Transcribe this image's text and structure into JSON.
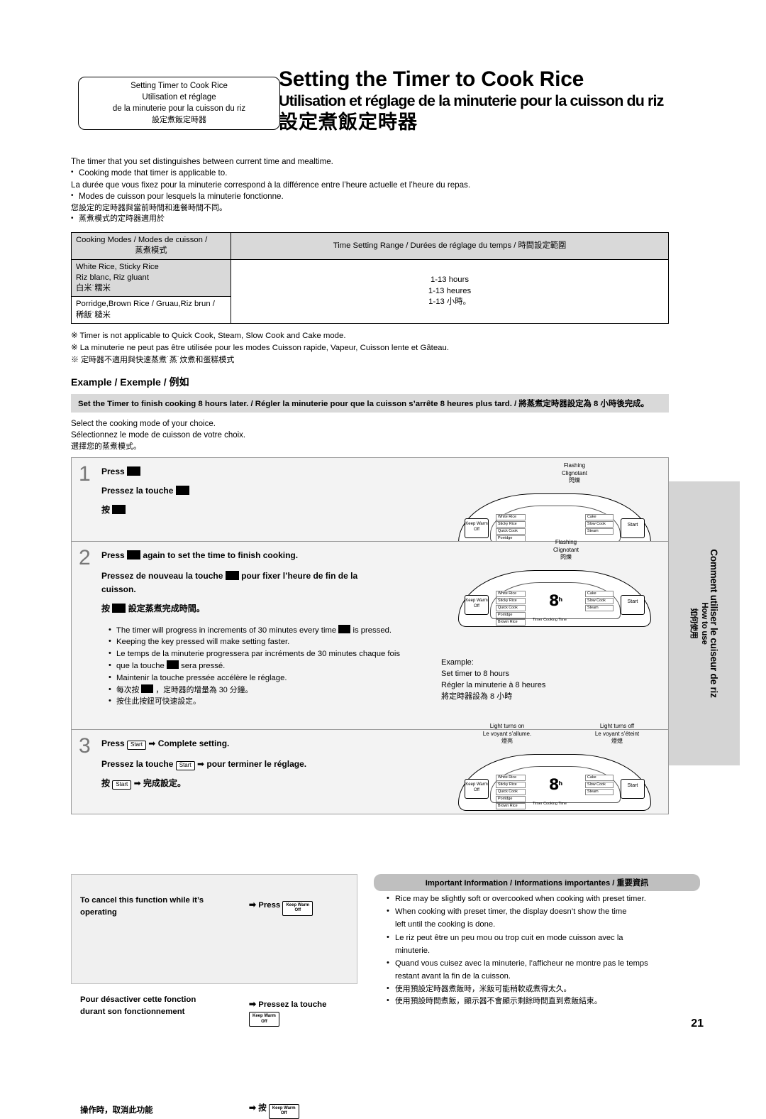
{
  "header": {
    "box": {
      "line1": "Setting Timer to Cook Rice",
      "line2": "Utilisation et réglage",
      "line3": "de la minuterie pour la cuisson du riz",
      "line4": "設定煮飯定時器"
    },
    "title_en": "Setting the Timer to Cook Rice",
    "title_fr": "Utilisation et réglage de la minuterie pour la cuisson du riz",
    "title_cn": "設定煮飯定時器"
  },
  "intro": {
    "l1": "The timer that you set distinguishes between current time and mealtime.",
    "l2": "Cooking mode that timer is applicable to.",
    "l3": "La durée que vous fixez pour la minuterie correspond à la différence entre l’heure actuelle et l’heure du repas.",
    "l4": "Modes de cuisson pour lesquels la minuterie fonctionne.",
    "l5": "您設定的定時器與當前時間和進餐時間不同。",
    "l6": "蒸煮模式的定時器適用於"
  },
  "table": {
    "head1_a": "Cooking Modes / Modes de cuisson /",
    "head1_b": "蒸煮模式",
    "head2": "Time Setting Range / Durées de réglage du temps / 時間設定範圍",
    "rows": [
      {
        "mode_l1": "White Rice, Sticky Rice",
        "mode_l2": "Riz blanc, Riz gluant",
        "mode_l3": "白米˙糯米",
        "range_l1": "1-13 hours",
        "range_l2": "1-13 heures",
        "range_l3": "1-13 小時。"
      },
      {
        "mode_l1": "Porridge,Brown Rice / Gruau,Riz brun /",
        "mode_l2": "稀飯˙糙米",
        "mode_l3": "",
        "range_l1": "",
        "range_l2": "",
        "range_l3": ""
      }
    ]
  },
  "notes": {
    "n1": "Timer is not applicable to Quick Cook, Steam, Slow Cook and Cake mode.",
    "n2": "La minuterie ne peut pas être utilisée pour les modes Cuisson rapide, Vapeur, Cuisson lente et Gâteau.",
    "n3": "定時器不適用與快速蒸煮˙蒸˙炆煮和蛋糕模式"
  },
  "example": {
    "title": "Example / Exemple / 例如",
    "bar": "Set the Timer to finish cooking 8 hours later. / Régler la minuterie pour que la cuisson s’arrête 8 heures plus tard. / 將蒸煮定時器設定為 8 小時後完成。",
    "select_en": "Select the cooking mode of your choice.",
    "select_fr": "Sélectionnez le mode de cuisson de votre choix.",
    "select_cn": "選擇您的蒸煮模式。"
  },
  "steps": [
    {
      "num": "1",
      "en_pre": "Press",
      "en_post": "",
      "fr_pre": "Pressez la touche",
      "fr_post": "",
      "cn_pre": "按",
      "cn_post": ""
    },
    {
      "num": "2",
      "en_pre": "Press",
      "en_post": "again to set the time to finish cooking.",
      "fr_pre": "Pressez de nouveau la touche",
      "fr_mid": "pour fixer l’heure de fin de la",
      "fr_post": "cuisson.",
      "cn_pre": "按",
      "cn_post": "設定蒸煮完成時間。"
    },
    {
      "num": "3",
      "en_pre": "Press",
      "en_post": "Complete setting.",
      "fr_pre": "Pressez la touche",
      "fr_post": "pour terminer le réglage.",
      "cn_pre": "按",
      "cn_post": "完成設定。"
    }
  ],
  "step2_bullets": {
    "b1_a": "The timer will progress in increments of 30 minutes every time",
    "b1_b": "is pressed.",
    "b2": "Keeping the key pressed will make setting faster.",
    "b3_a": "Le temps de la minuterie progressera par incréments de 30 minutes chaque fois",
    "b3_b": "que la touche",
    "b3_c": "sera pressé.",
    "b4": "Maintenir la touche pressée accélère le réglage.",
    "b5_a": "每次按",
    "b5_b": "，定時器的增量為 30 分鐘。",
    "b6": "按住此按鈕可快速設定。"
  },
  "panels": {
    "p1": {
      "callout_en": "Flashing",
      "callout_fr": "Clignotant",
      "callout_cn": "閃爍",
      "lcd": "",
      "lcd_sub": ""
    },
    "p2": {
      "callout_en": "Flashing",
      "callout_fr": "Clignotant",
      "callout_cn": "閃爍",
      "lcd": "8",
      "lcd_unit": "h",
      "lcd_sub": ""
    },
    "p3": {
      "left_en": "Light turns on",
      "left_fr": "Le voyant s’allume.",
      "left_cn": "燈亮",
      "right_en": "Light turns off",
      "right_fr": "Le voyant s’éteint",
      "right_cn": "燈熄",
      "lcd": "8",
      "lcd_unit": "h"
    },
    "buttons": {
      "keep_warm_l1": "Keep Warm",
      "keep_warm_l2": "Off",
      "start": "Start",
      "left_items": [
        "White Rice",
        "Sticky Rice",
        "Quick Cook",
        "Porridge",
        "Brown Rice"
      ],
      "right_items": [
        "Cake",
        "Slow Cook",
        "Steam"
      ],
      "bottom_label": "Timer   Cooking Time"
    }
  },
  "example_note": {
    "l1": "Example:",
    "l2": "Set timer to 8 hours",
    "l3": "Régler la minuterie à 8 heures",
    "l4": "將定時器設為 8 小時"
  },
  "cancel": {
    "en_l1": "To cancel this function while it’s",
    "en_l2": "operating",
    "en_press": "Press",
    "fr_l1": "Pour désactiver cette fonction",
    "fr_l2": "durant son fonctionnement",
    "fr_press": "Pressez la touche",
    "cn_l1": "操作時，取消此功能",
    "cn_press": "按",
    "key_l1": "Keep Warm",
    "key_l2": "Off"
  },
  "important": {
    "title": "Important Information / Informations importantes / 重要資訊",
    "items": [
      "Rice may be slightly soft or overcooked when cooking with preset timer.",
      "When cooking with preset timer, the display doesn’t show the time",
      "left until the cooking is done.",
      "Le riz peut être un peu mou ou trop cuit en mode cuisson avec la",
      "minuterie.",
      "Quand vous cuisez avec la minuterie, l’afficheur ne montre pas le temps",
      "restant avant la fin de la cuisson.",
      "使用預設定時器煮飯時，米飯可能稍軟或煮得太久。",
      "使用預設時間煮飯，顯示器不會顯示剩餘時間直到煮飯結束。"
    ]
  },
  "side_tab": {
    "en": "How to use",
    "fr": "Comment utiliser le cuiseur de riz",
    "cn": "如何使用"
  },
  "page_number": "21"
}
